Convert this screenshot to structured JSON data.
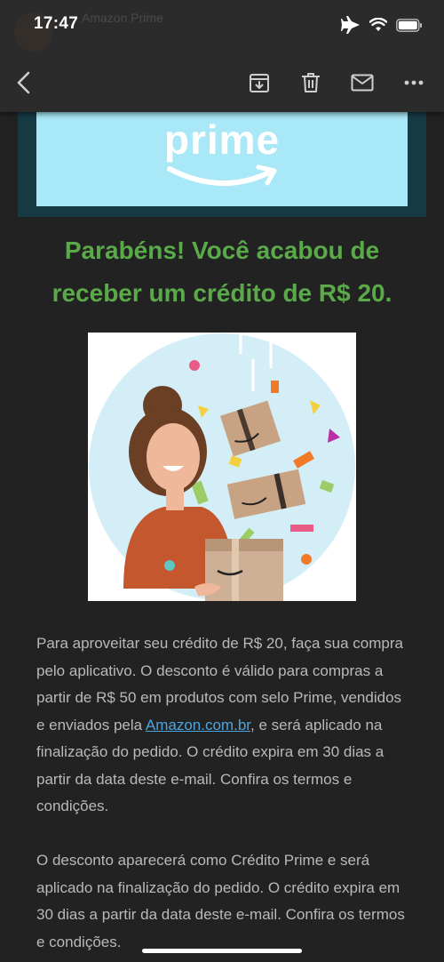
{
  "status_bar": {
    "time": "17:47",
    "ghost_sender": "Amazon Prime",
    "icons": [
      "airplane-icon",
      "wifi-icon",
      "battery-icon"
    ]
  },
  "toolbar": {
    "icons": [
      "back-icon",
      "archive-icon",
      "delete-icon",
      "mark-unread-icon",
      "more-icon"
    ]
  },
  "email": {
    "banner": {
      "logo_text": "prime",
      "colors": {
        "frame": "#173a45",
        "background": "#a9e8f6",
        "logo": "#ffffff"
      }
    },
    "headline": "Parabéns! Você acabou de receber um crédito de R$ 20.",
    "headline_color": "#5aaa4a",
    "body": {
      "p1_before_link": "Para aproveitar seu crédito de R$ 20, faça sua compra pelo aplicativo. O desconto é válido para compras a partir de R$ 50 em produtos com selo Prime, vendidos e enviados pela ",
      "p1_link": "Amazon.com.br",
      "p1_after_link": ", e será aplicado na finalização do pedido. O crédito expira em 30 dias a partir da data deste e-mail. Confira os termos e condições.",
      "p2": "O desconto aparecerá como Crédito Prime e será aplicado na finalização do pedido. O crédito expira em 30 dias a partir da data deste e-mail. Confira os termos e condições."
    },
    "link_color": "#4aa6e0"
  }
}
